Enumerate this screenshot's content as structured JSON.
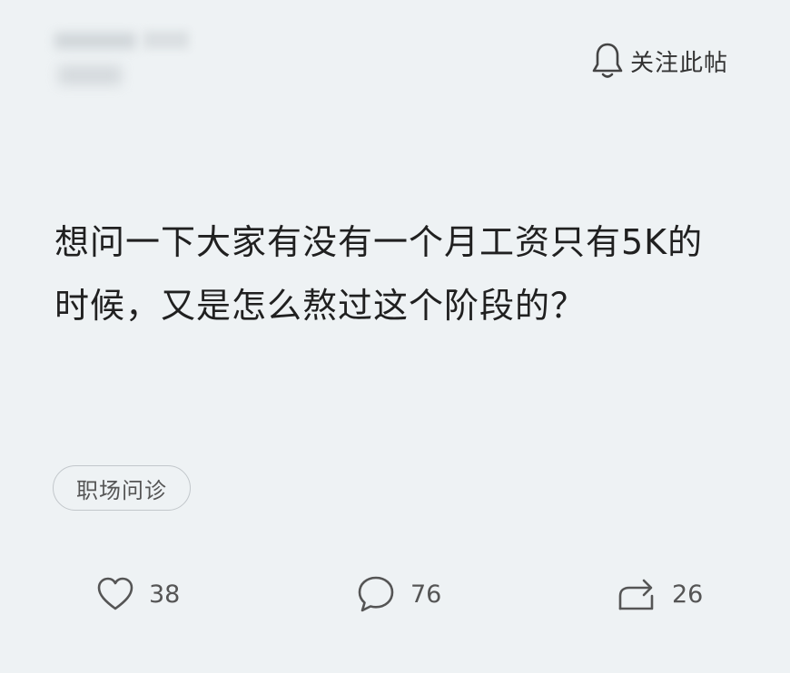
{
  "header": {
    "follow_label": "关注此帖"
  },
  "post": {
    "line1": "想问一下大家有没有一个月工资只有5K的",
    "line2": "时候，又是怎么熬过这个阶段的？"
  },
  "tag": {
    "label": "职场问诊"
  },
  "actions": {
    "likes": "38",
    "comments": "76",
    "shares": "26"
  },
  "icons": {
    "follow": "bell-icon",
    "like": "heart-icon",
    "comment": "comment-bubble-icon",
    "share": "share-arrow-icon"
  },
  "colors": {
    "background": "#eef2f4",
    "text": "#202020",
    "muted": "#555555"
  }
}
